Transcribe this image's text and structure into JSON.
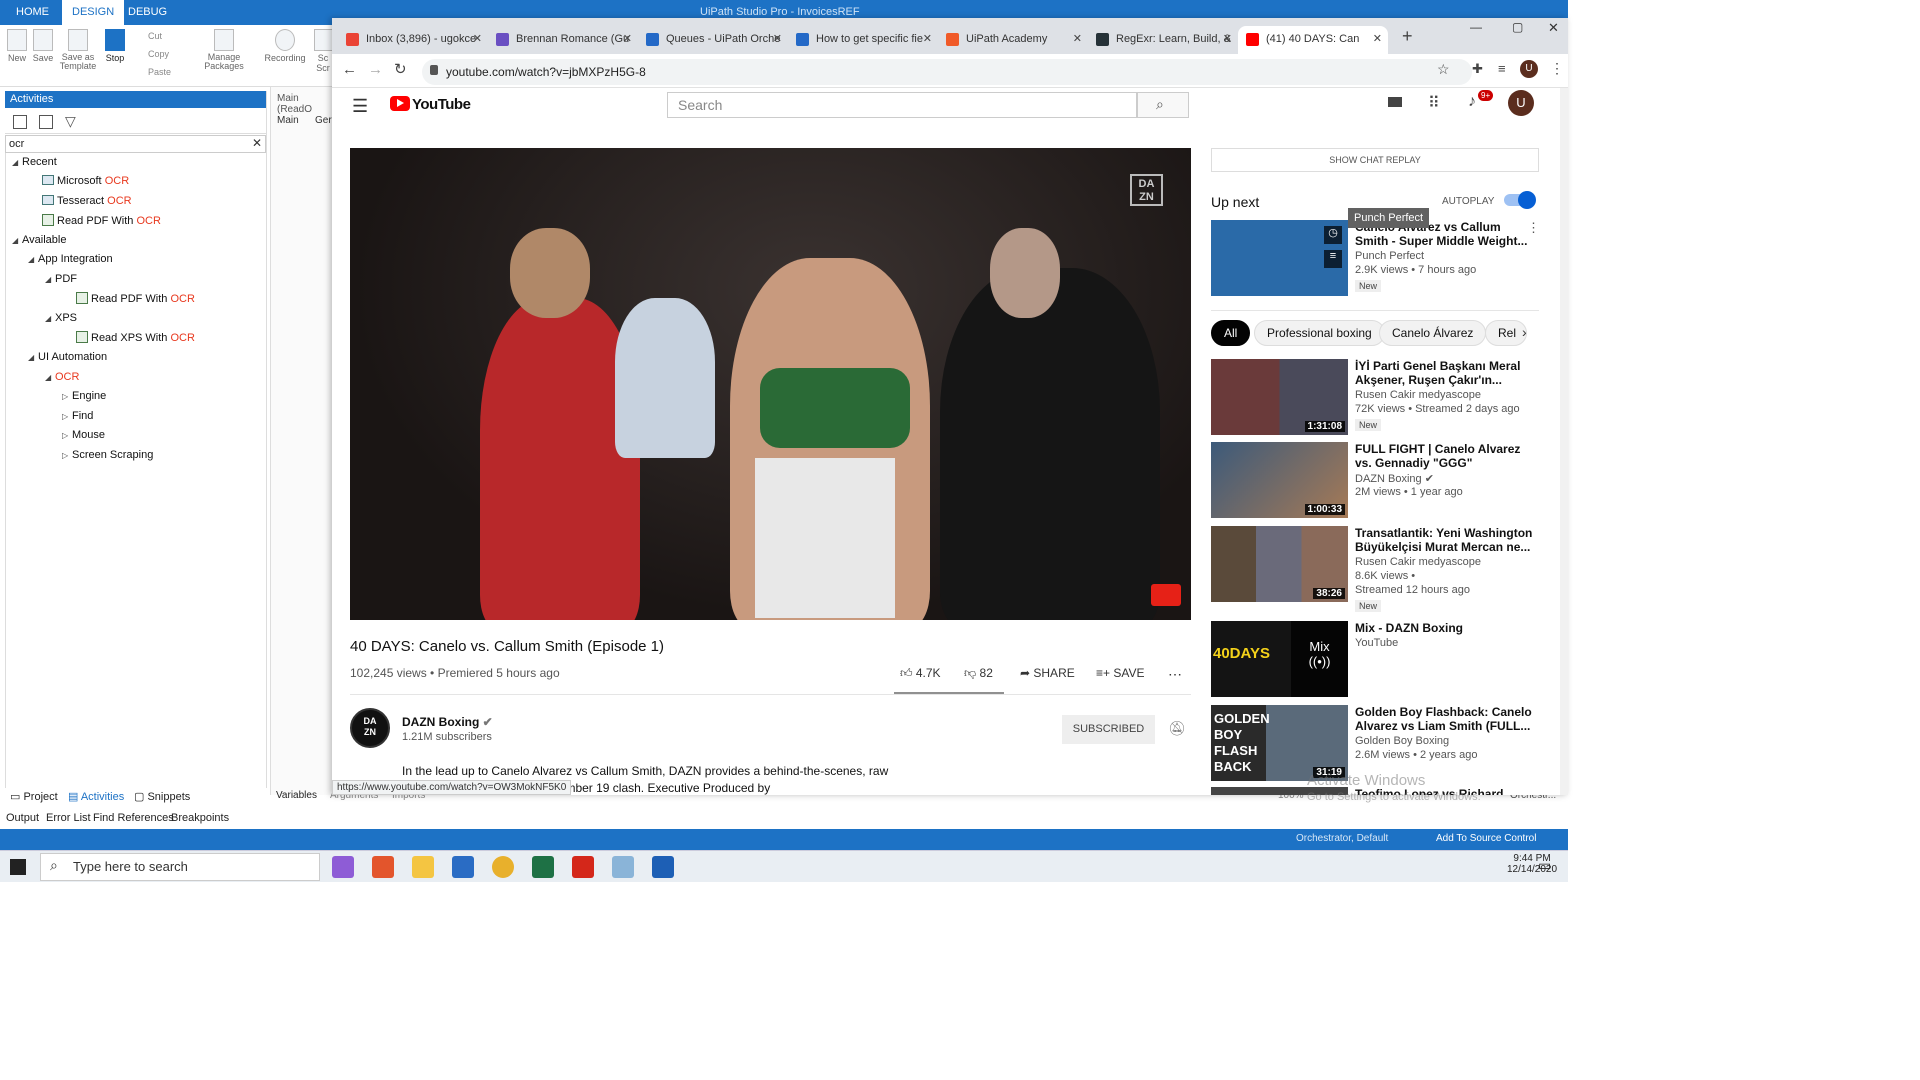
{
  "uipath": {
    "tabs": [
      "HOME",
      "DESIGN",
      "DEBUG"
    ],
    "window_title": "UiPath Studio Pro - InvoicesREF",
    "ribbon": {
      "new": "New",
      "save": "Save",
      "save_template": "Save as Template",
      "stop": "Stop",
      "cut": "Cut",
      "copy": "Copy",
      "paste": "Paste",
      "manage_packages": "Manage Packages",
      "recording": "Recording",
      "scr": "Sc Scr"
    },
    "activities": {
      "title": "Activities",
      "search_value": "ocr",
      "tree": {
        "recent": "Recent",
        "microsoft": "Microsoft ",
        "tesseract": "Tesseract ",
        "read_pdf": "Read PDF With ",
        "ocr": "OCR",
        "available": "Available",
        "app_integration": "App Integration",
        "pdf": "PDF",
        "read_pdf2": "Read PDF With ",
        "xps": "XPS",
        "read_xps": "Read XPS With ",
        "ui_automation": "UI Automation",
        "ocr_group": "OCR",
        "engine": "Engine",
        "find": "Find",
        "mouse": "Mouse",
        "screen_scraping": "Screen Scraping"
      }
    },
    "main_tab": "Main (ReadO",
    "breadcrumb": [
      "Main",
      "Ger"
    ],
    "panel_tabs": [
      "Project",
      "Activities",
      "Snippets"
    ],
    "bottom_tabs": [
      "Output",
      "Error List",
      "Find References",
      "Breakpoints"
    ],
    "designer_tabs": [
      "Variables",
      "Arguments",
      "Imports"
    ],
    "status": {
      "orchestrator": "Orchestrator, Default",
      "source_control": "Add To Source Control",
      "zoom": "100%",
      "orch_short": "Orchestr..."
    }
  },
  "chrome": {
    "tabs": [
      {
        "title": "Inbox (3,896) - ugokce",
        "color": "#ea4335"
      },
      {
        "title": "Brennan Romance (Gu",
        "color": "#6a4fc2"
      },
      {
        "title": "Queues - UiPath Orche",
        "color": "#2469c7"
      },
      {
        "title": "How to get specific fie",
        "color": "#2469c7"
      },
      {
        "title": "UiPath Academy",
        "color": "#f05a28"
      },
      {
        "title": "RegExr: Learn, Build, &",
        "color": "#263238"
      },
      {
        "title": "(41) 40 DAYS: Can",
        "color": "#ff0000"
      }
    ],
    "url": "youtube.com/watch?v=jbMXPzH5G-8",
    "avatar": "U"
  },
  "youtube": {
    "logo": "YouTube",
    "search_placeholder": "Search",
    "notif_badge": "9+",
    "watermark": "DA ZN",
    "video": {
      "title": "40 DAYS: Canelo vs. Callum Smith (Episode 1)",
      "meta": "102,245 views • Premiered 5 hours ago",
      "likes": "4.7K",
      "dislikes": "82",
      "share": "SHARE",
      "save": "SAVE"
    },
    "channel": {
      "avatar": "DA ZN",
      "name": "DAZN Boxing",
      "subs": "1.21M subscribers",
      "subscribe": "SUBSCRIBED"
    },
    "description": "In the lead up to Canelo Alvarez vs Callum Smith, DAZN provides a behind-the-scenes, raw and ...ions ahead of their December 19 clash. Executive Produced by",
    "hover_url": "https://www.youtube.com/watch?v=OW3MokNF5K0",
    "chat_replay": "SHOW CHAT REPLAY",
    "up_next": "Up next",
    "autoplay": "AUTOPLAY",
    "tooltip": "Punch Perfect",
    "chips": [
      "All",
      "Professional boxing",
      "Canelo Álvarez",
      "Rel"
    ],
    "videos": [
      {
        "title": "Canelo Alvarez vs Callum Smith - Super Middle Weight...",
        "channel": "Punch Perfect",
        "views": "2.9K views • 7 hours ago",
        "new": "New",
        "duration": "",
        "color": "#2a6aa8"
      },
      {
        "title": "İYİ Parti Genel Başkanı Meral Akşener, Ruşen Çakır'ın...",
        "channel": "Rusen Cakir medyascope",
        "views": "72K views • Streamed 2 days ago",
        "new": "New",
        "duration": "1:31:08",
        "color": "#7a3a3a"
      },
      {
        "title": "FULL FIGHT | Canelo Alvarez vs. Gennadiy \"GGG\" Golovkin...",
        "channel": "DAZN Boxing ✔",
        "views": "2M views • 1 year ago",
        "new": "",
        "duration": "1:00:33",
        "color": "#8a6a4a"
      },
      {
        "title": "Transatlantik: Yeni Washington Büyükelçisi Murat Mercan ne...",
        "channel": "Rusen Cakir medyascope",
        "views": "8.6K views •",
        "views2": "Streamed 12 hours ago",
        "new": "New",
        "duration": "38:26",
        "color": "#6a5a4a"
      },
      {
        "title": "Mix - DAZN Boxing",
        "channel": "YouTube",
        "views": "",
        "new": "",
        "duration": "",
        "mix": "Mix",
        "badge": "40DAYS",
        "color": "#1a1a1a"
      },
      {
        "title": "Golden Boy Flashback: Canelo Alvarez vs Liam Smith (FULL...",
        "channel": "Golden Boy Boxing",
        "views": "2.6M views • 2 years ago",
        "new": "",
        "duration": "31:19",
        "badge": "GOLDEN BOY FLASH BACK",
        "color": "#3a3a3a"
      },
      {
        "title": "Teofimo Lopez vs Richard",
        "channel": "",
        "views": "",
        "new": "",
        "duration": "",
        "color": "#444"
      }
    ],
    "activate": "Activate Windows",
    "activate_sub": "Go to Settings to activate Windows."
  },
  "taskbar": {
    "search": "Type here to search",
    "time": "9:44 PM",
    "date": "12/14/2020"
  },
  "colors": {
    "uipath_blue": "#1d72c5",
    "youtube_red": "#ff0000",
    "ocr_highlight": "#e8381e"
  }
}
